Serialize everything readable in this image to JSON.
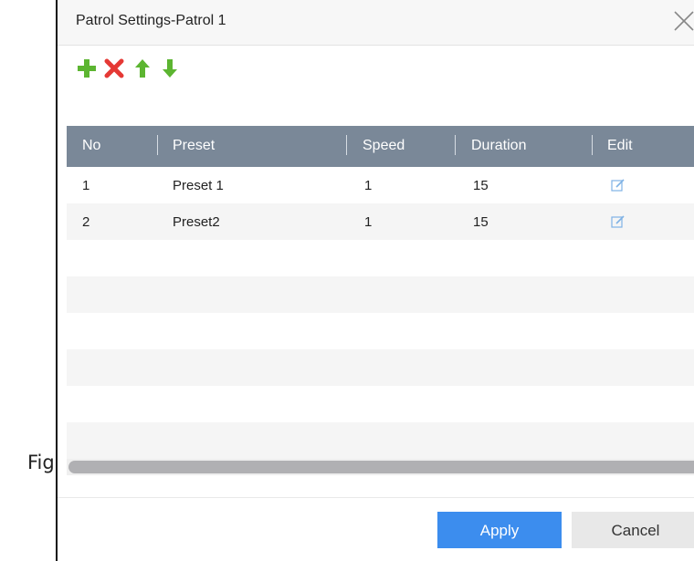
{
  "background": {
    "partial_text": "Figu"
  },
  "dialog": {
    "title": "Patrol Settings-Patrol 1"
  },
  "toolbar": {
    "add_icon": "plus-icon",
    "delete_icon": "x-icon",
    "up_icon": "arrow-up-icon",
    "down_icon": "arrow-down-icon"
  },
  "table": {
    "headers": [
      "No",
      "Preset",
      "Speed",
      "Duration",
      "Edit"
    ],
    "rows": [
      {
        "no": "1",
        "preset": "Preset 1",
        "speed": "1",
        "duration": "15"
      },
      {
        "no": "2",
        "preset": "Preset2",
        "speed": "1",
        "duration": "15"
      }
    ]
  },
  "buttons": {
    "apply": "Apply",
    "cancel": "Cancel"
  },
  "colors": {
    "header_bg": "#7a8898",
    "apply_bg": "#3c8dee",
    "icon_green": "#5cb531",
    "icon_red": "#e53935",
    "edit_icon": "#7fb2e5"
  }
}
